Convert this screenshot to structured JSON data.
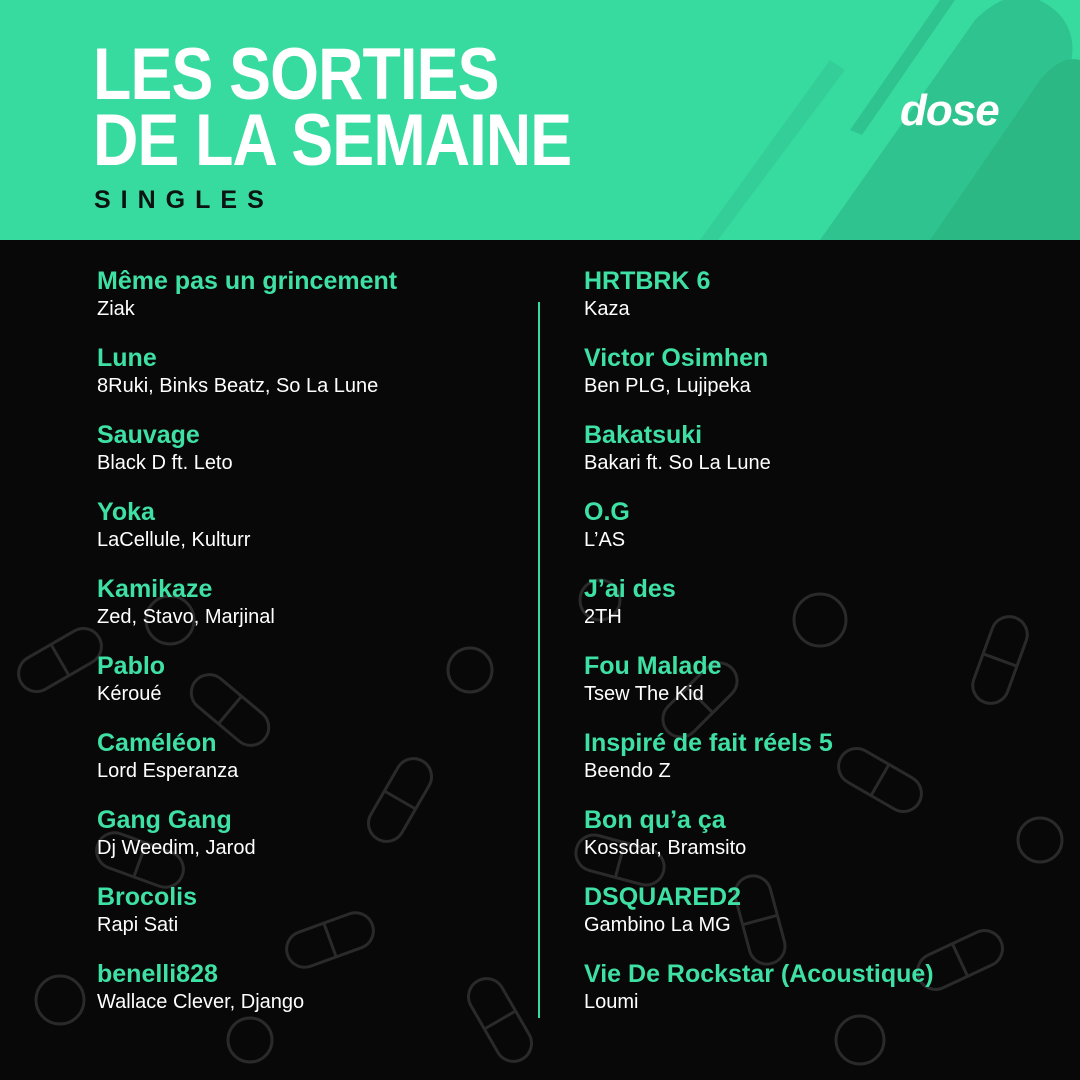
{
  "header": {
    "title_line1": "LES SORTIES",
    "title_line2": "DE LA SEMAINE",
    "subtitle": "SINGLES",
    "brand": "dose"
  },
  "colors": {
    "accent": "#37dba0",
    "song_title": "#3ee0a4",
    "background": "#080808",
    "text": "#ffffff"
  },
  "left_column": [
    {
      "title": "Même pas un grincement",
      "artists": "Ziak"
    },
    {
      "title": "Lune",
      "artists": "8Ruki, Binks Beatz, So La Lune"
    },
    {
      "title": "Sauvage",
      "artists": "Black D ft. Leto"
    },
    {
      "title": "Yoka",
      "artists": "LaCellule, Kulturr"
    },
    {
      "title": "Kamikaze",
      "artists": "Zed, Stavo, Marjinal"
    },
    {
      "title": "Pablo",
      "artists": "Kéroué"
    },
    {
      "title": "Caméléon",
      "artists": "Lord Esperanza"
    },
    {
      "title": "Gang Gang",
      "artists": "Dj Weedim, Jarod"
    },
    {
      "title": "Brocolis",
      "artists": "Rapi Sati"
    },
    {
      "title": "benelli828",
      "artists": "Wallace Clever, Django"
    }
  ],
  "right_column": [
    {
      "title": "HRTBRK 6",
      "artists": "Kaza"
    },
    {
      "title": "Victor Osimhen",
      "artists": "Ben PLG, Lujipeka"
    },
    {
      "title": "Bakatsuki",
      "artists": "Bakari ft. So La Lune"
    },
    {
      "title": "O.G",
      "artists": "L’AS"
    },
    {
      "title": "J’ai des",
      "artists": "2TH"
    },
    {
      "title": "Fou Malade",
      "artists": "Tsew The Kid"
    },
    {
      "title": "Inspiré de fait réels 5",
      "artists": "Beendo Z"
    },
    {
      "title": "Bon qu’a ça",
      "artists": "Kossdar, Bramsito"
    },
    {
      "title": "DSQUARED2",
      "artists": "Gambino La MG"
    },
    {
      "title": "Vie De Rockstar (Acoustique)",
      "artists": "Loumi"
    }
  ]
}
